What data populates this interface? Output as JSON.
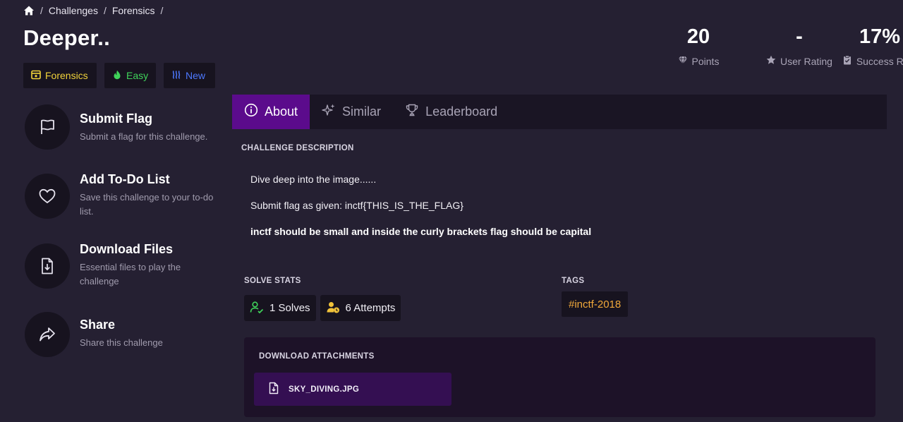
{
  "breadcrumb": {
    "items": [
      "Challenges",
      "Forensics"
    ],
    "separator": "/"
  },
  "title": "Deeper..",
  "badges": {
    "category": "Forensics",
    "difficulty": "Easy",
    "status": "New"
  },
  "stats": {
    "points": {
      "value": "20",
      "label": "Points"
    },
    "rating": {
      "value": "-",
      "label": "User Rating"
    },
    "success": {
      "value": "17%",
      "label": "Success Rate"
    }
  },
  "actions": [
    {
      "title": "Submit Flag",
      "subtitle": "Submit a flag for this challenge.",
      "icon": "flag-icon"
    },
    {
      "title": "Add To-Do List",
      "subtitle": "Save this challenge to your to-do list.",
      "icon": "heart-icon"
    },
    {
      "title": "Download Files",
      "subtitle": "Essential files to play the challenge",
      "icon": "file-download-icon"
    },
    {
      "title": "Share",
      "subtitle": "Share this challenge",
      "icon": "share-icon"
    }
  ],
  "tabs": [
    "About",
    "Similar",
    "Leaderboard"
  ],
  "about": {
    "description_label": "CHALLENGE DESCRIPTION",
    "lines": [
      "Dive deep into the image......",
      "Submit flag as given: inctf{THIS_IS_THE_FLAG}",
      "inctf should be small and inside the curly brackets flag should be capital"
    ],
    "solve_stats_label": "SOLVE STATS",
    "solves": "1 Solves",
    "attempts": "6 Attempts",
    "tags_label": "TAGS",
    "tags": [
      "#inctf-2018"
    ],
    "attachments_label": "DOWNLOAD ATTACHMENTS",
    "attachments": [
      "SKY_DIVING.JPG"
    ]
  },
  "colors": {
    "background": "#252032",
    "panel": "#17131f",
    "accent": "#5b0b8c",
    "forensics": "#f0d23a",
    "easy": "#3fd35a",
    "new": "#4d79ff",
    "tag": "#f0a83a"
  }
}
